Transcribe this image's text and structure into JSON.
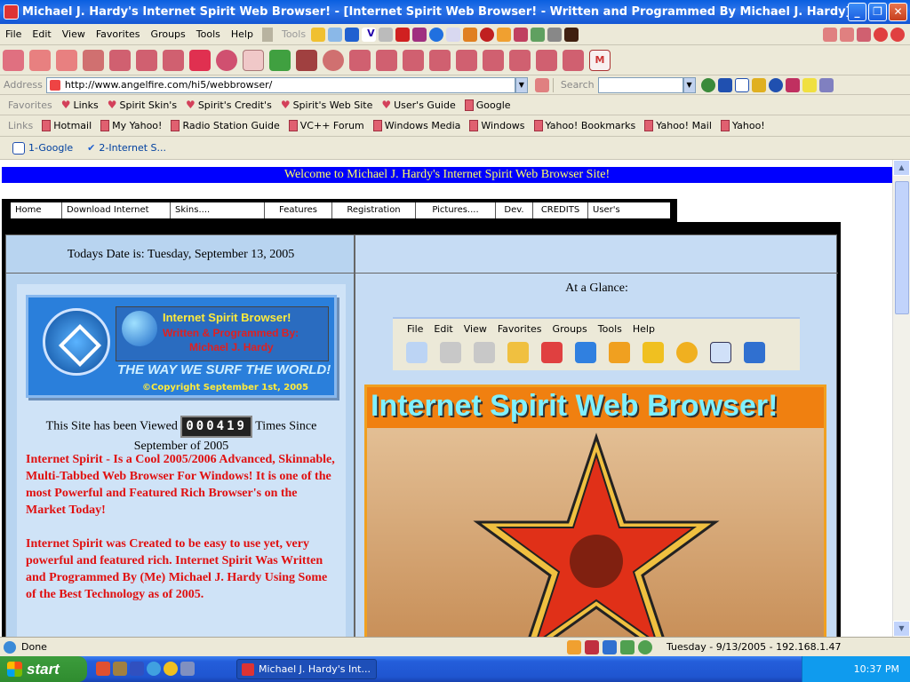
{
  "window": {
    "title": "Michael J. Hardy's Internet Spirit Web Browser! - [Internet Spirit Web Browser! - Written and Programmed By Michael J. Hardy]"
  },
  "menu": {
    "items": [
      "File",
      "Edit",
      "View",
      "Favorites",
      "Groups",
      "Tools",
      "Help"
    ],
    "tools_label": "Tools"
  },
  "address": {
    "label": "Address",
    "url": "http://www.angelfire.com/hi5/webbrowser/",
    "search_label": "Search"
  },
  "favorites": {
    "label": "Favorites",
    "items": [
      "Links",
      "Spirit Skin's",
      "Spirit's Credit's",
      "Spirit's Web Site",
      "User's Guide",
      "Google"
    ]
  },
  "links": {
    "label": "Links",
    "items": [
      "Hotmail",
      "My Yahoo!",
      "Radio Station Guide",
      "VC++ Forum",
      "Windows Media",
      "Windows",
      "Yahoo! Bookmarks",
      "Yahoo! Mail",
      "Yahoo!"
    ]
  },
  "tabs": [
    {
      "label": "1-Google"
    },
    {
      "label": "2-Internet S..."
    }
  ],
  "page": {
    "welcome": "Welcome to Michael J. Hardy's Internet Spirit Web Browser Site!",
    "nav": [
      "Home",
      "Download Internet Spirit",
      "Skins....",
      "Features",
      "Registration",
      "Pictures....",
      "Dev.",
      "CREDITS",
      "User's Guide."
    ],
    "date": "Todays Date is: Tuesday, September 13, 2005",
    "banner": {
      "t1": "Internet Spirit Browser!",
      "t2": "Written & Programmed By:",
      "t3": "Michael J. Hardy",
      "slogan": "THE WAY WE SURF THE WORLD!",
      "copyright": "©Copyright September 1st, 2005"
    },
    "counter_pre": "This Site has been Viewed",
    "counter": "000419",
    "counter_post": "Times Since",
    "counter_post2": "September of 2005",
    "para1": "Internet Spirit - Is a Cool 2005/2006 Advanced, Skinnable, Multi-Tabbed Web Browser For Windows! It is one of the most Powerful and Featured Rich Browser's on the Market Today!",
    "para2": "Internet Spirit was Created to be easy to use yet, very powerful and featured rich. Internet Spirit Was Written and Programmed By (Me) Michael J. Hardy Using Some of the Best Technology as of 2005.",
    "glance": "At a Glance:",
    "shot_menu": [
      "File",
      "Edit",
      "View",
      "Favorites",
      "Groups",
      "Tools",
      "Help"
    ],
    "bigpic_title": "Internet Spirit  Web Browser!"
  },
  "status": {
    "text": "Done",
    "right": "Tuesday - 9/13/2005 - 192.168.1.47"
  },
  "taskbar": {
    "start": "start",
    "task": "Michael J. Hardy's Int...",
    "clock": "10:37 PM"
  }
}
